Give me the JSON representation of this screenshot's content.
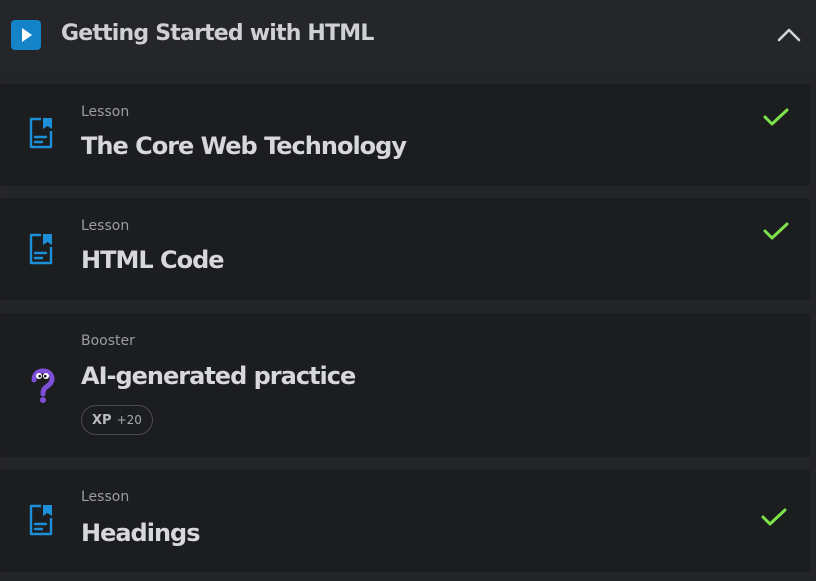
{
  "section": {
    "title": "Getting Started with HTML",
    "play_icon": "play-icon",
    "collapse_icon": "chevron-up-icon"
  },
  "items": [
    {
      "kind": "Lesson",
      "title": "The Core Web Technology",
      "icon": "lesson-document-icon",
      "completed": true
    },
    {
      "kind": "Lesson",
      "title": "HTML Code",
      "icon": "lesson-document-icon",
      "completed": true
    },
    {
      "kind": "Booster",
      "title": "AI-generated practice",
      "icon": "question-mark-character-icon",
      "completed": false,
      "xp_badge": {
        "label": "XP",
        "value": "+20"
      }
    },
    {
      "kind": "Lesson",
      "title": "Headings",
      "icon": "lesson-document-icon",
      "completed": true
    }
  ],
  "colors": {
    "accent_blue": "#1583c8",
    "check_green": "#7ee34a",
    "booster_purple": "#7e4fd8",
    "background": "#242526",
    "card": "#1c1d1f"
  }
}
